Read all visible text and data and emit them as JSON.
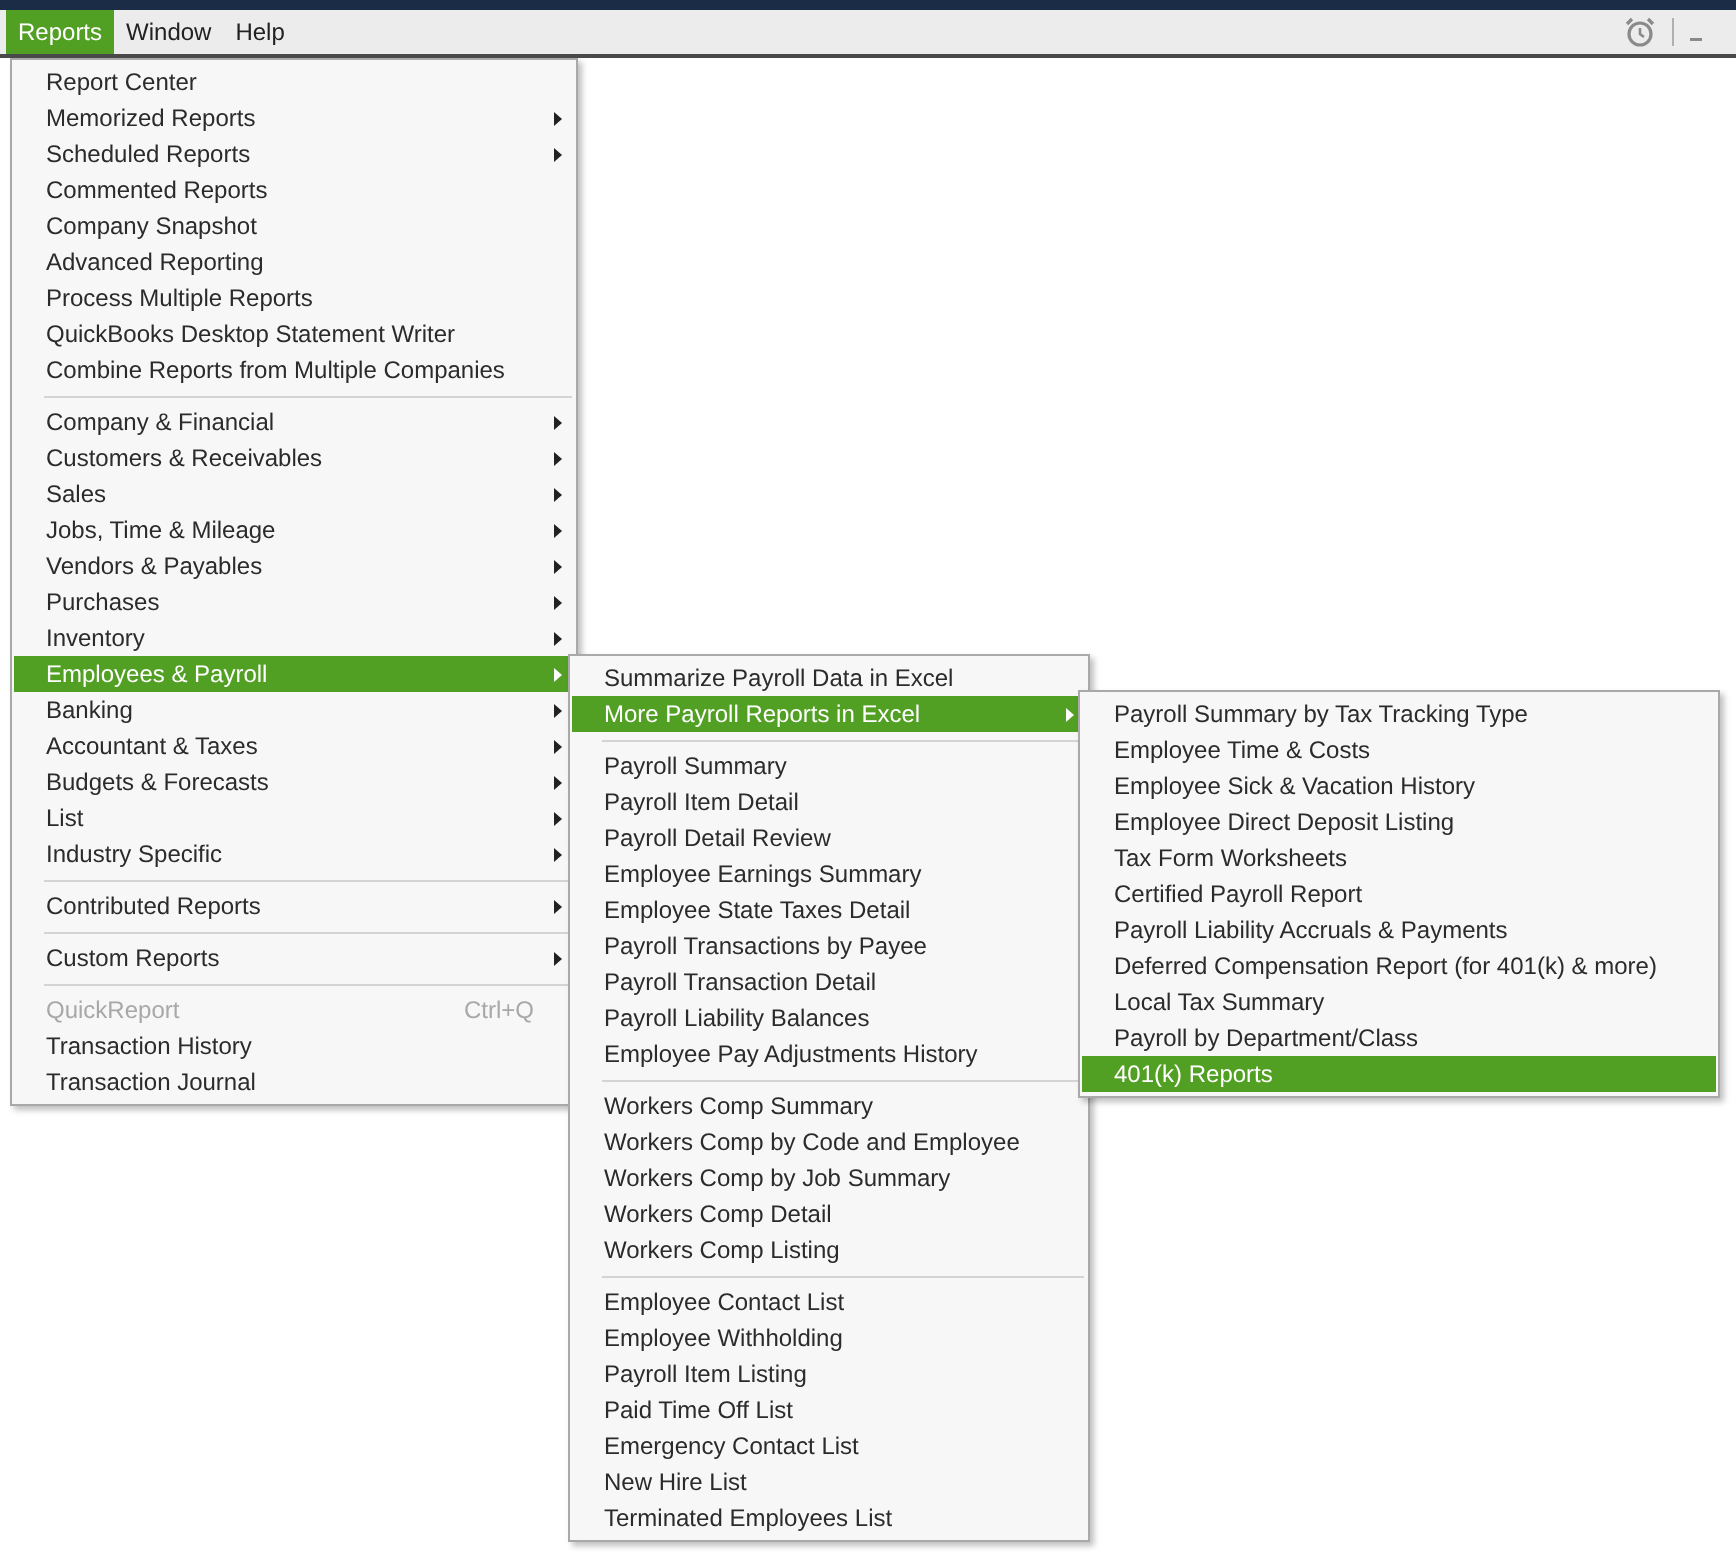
{
  "menubar": [
    {
      "label": "Reports",
      "selected": true
    },
    {
      "label": "Window",
      "selected": false
    },
    {
      "label": "Help",
      "selected": false
    }
  ],
  "reports_menu": {
    "groups": [
      [
        {
          "label": "Report Center",
          "submenu": false,
          "selected": false,
          "disabled": false
        },
        {
          "label": "Memorized Reports",
          "submenu": true,
          "selected": false,
          "disabled": false
        },
        {
          "label": "Scheduled Reports",
          "submenu": true,
          "selected": false,
          "disabled": false
        },
        {
          "label": "Commented Reports",
          "submenu": false,
          "selected": false,
          "disabled": false
        },
        {
          "label": "Company Snapshot",
          "submenu": false,
          "selected": false,
          "disabled": false
        },
        {
          "label": "Advanced Reporting",
          "submenu": false,
          "selected": false,
          "disabled": false
        },
        {
          "label": "Process Multiple Reports",
          "submenu": false,
          "selected": false,
          "disabled": false
        },
        {
          "label": "QuickBooks Desktop Statement Writer",
          "submenu": false,
          "selected": false,
          "disabled": false
        },
        {
          "label": "Combine Reports from Multiple Companies",
          "submenu": false,
          "selected": false,
          "disabled": false
        }
      ],
      [
        {
          "label": "Company & Financial",
          "submenu": true,
          "selected": false,
          "disabled": false
        },
        {
          "label": "Customers & Receivables",
          "submenu": true,
          "selected": false,
          "disabled": false
        },
        {
          "label": "Sales",
          "submenu": true,
          "selected": false,
          "disabled": false
        },
        {
          "label": "Jobs, Time & Mileage",
          "submenu": true,
          "selected": false,
          "disabled": false
        },
        {
          "label": "Vendors & Payables",
          "submenu": true,
          "selected": false,
          "disabled": false
        },
        {
          "label": "Purchases",
          "submenu": true,
          "selected": false,
          "disabled": false
        },
        {
          "label": "Inventory",
          "submenu": true,
          "selected": false,
          "disabled": false
        },
        {
          "label": "Employees & Payroll",
          "submenu": true,
          "selected": true,
          "disabled": false
        },
        {
          "label": "Banking",
          "submenu": true,
          "selected": false,
          "disabled": false
        },
        {
          "label": "Accountant & Taxes",
          "submenu": true,
          "selected": false,
          "disabled": false
        },
        {
          "label": "Budgets & Forecasts",
          "submenu": true,
          "selected": false,
          "disabled": false
        },
        {
          "label": "List",
          "submenu": true,
          "selected": false,
          "disabled": false
        },
        {
          "label": "Industry Specific",
          "submenu": true,
          "selected": false,
          "disabled": false
        }
      ],
      [
        {
          "label": "Contributed Reports",
          "submenu": true,
          "selected": false,
          "disabled": false
        }
      ],
      [
        {
          "label": "Custom Reports",
          "submenu": true,
          "selected": false,
          "disabled": false
        }
      ],
      [
        {
          "label": "QuickReport",
          "shortcut": "Ctrl+Q",
          "submenu": false,
          "selected": false,
          "disabled": true
        },
        {
          "label": "Transaction History",
          "submenu": false,
          "selected": false,
          "disabled": false
        },
        {
          "label": "Transaction Journal",
          "submenu": false,
          "selected": false,
          "disabled": false
        }
      ]
    ]
  },
  "payroll_menu": {
    "groups": [
      [
        {
          "label": "Summarize Payroll Data in Excel",
          "submenu": false,
          "selected": false
        },
        {
          "label": "More Payroll Reports in Excel",
          "submenu": true,
          "selected": true
        }
      ],
      [
        {
          "label": "Payroll Summary",
          "submenu": false,
          "selected": false
        },
        {
          "label": "Payroll Item Detail",
          "submenu": false,
          "selected": false
        },
        {
          "label": "Payroll Detail Review",
          "submenu": false,
          "selected": false
        },
        {
          "label": "Employee Earnings Summary",
          "submenu": false,
          "selected": false
        },
        {
          "label": "Employee State Taxes Detail",
          "submenu": false,
          "selected": false
        },
        {
          "label": "Payroll Transactions by Payee",
          "submenu": false,
          "selected": false
        },
        {
          "label": "Payroll Transaction Detail",
          "submenu": false,
          "selected": false
        },
        {
          "label": "Payroll Liability Balances",
          "submenu": false,
          "selected": false
        },
        {
          "label": "Employee Pay Adjustments History",
          "submenu": false,
          "selected": false
        }
      ],
      [
        {
          "label": "Workers Comp Summary",
          "submenu": false,
          "selected": false
        },
        {
          "label": "Workers Comp by Code and Employee",
          "submenu": false,
          "selected": false
        },
        {
          "label": "Workers Comp by Job Summary",
          "submenu": false,
          "selected": false
        },
        {
          "label": "Workers Comp Detail",
          "submenu": false,
          "selected": false
        },
        {
          "label": "Workers Comp Listing",
          "submenu": false,
          "selected": false
        }
      ],
      [
        {
          "label": "Employee Contact List",
          "submenu": false,
          "selected": false
        },
        {
          "label": "Employee Withholding",
          "submenu": false,
          "selected": false
        },
        {
          "label": "Payroll Item Listing",
          "submenu": false,
          "selected": false
        },
        {
          "label": "Paid Time Off List",
          "submenu": false,
          "selected": false
        },
        {
          "label": "Emergency Contact List",
          "submenu": false,
          "selected": false
        },
        {
          "label": "New Hire List",
          "submenu": false,
          "selected": false
        },
        {
          "label": "Terminated Employees List",
          "submenu": false,
          "selected": false
        }
      ]
    ]
  },
  "excel_menu": {
    "groups": [
      [
        {
          "label": "Payroll Summary by Tax Tracking Type",
          "submenu": false,
          "selected": false
        },
        {
          "label": "Employee Time & Costs",
          "submenu": false,
          "selected": false
        },
        {
          "label": "Employee Sick & Vacation History",
          "submenu": false,
          "selected": false
        },
        {
          "label": "Employee Direct Deposit Listing",
          "submenu": false,
          "selected": false
        },
        {
          "label": "Tax Form Worksheets",
          "submenu": false,
          "selected": false
        },
        {
          "label": "Certified Payroll Report",
          "submenu": false,
          "selected": false
        },
        {
          "label": "Payroll Liability Accruals & Payments",
          "submenu": false,
          "selected": false
        },
        {
          "label": "Deferred Compensation Report (for 401(k) & more)",
          "submenu": false,
          "selected": false
        },
        {
          "label": "Local Tax Summary",
          "submenu": false,
          "selected": false
        },
        {
          "label": "Payroll by Department/Class",
          "submenu": false,
          "selected": false
        },
        {
          "label": "401(k) Reports",
          "submenu": false,
          "selected": true
        }
      ]
    ]
  }
}
